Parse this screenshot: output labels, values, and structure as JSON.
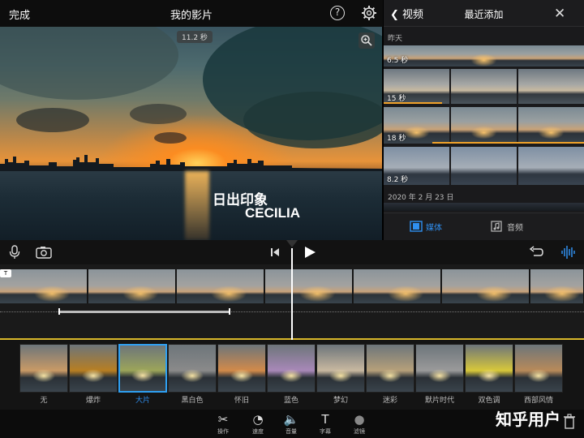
{
  "topbar": {
    "done": "完成",
    "title": "我的影片",
    "help": "?"
  },
  "preview": {
    "duration": "11.2 秒",
    "caption_line1": "日出印象",
    "caption_line2": "CECILIA"
  },
  "media": {
    "back": "视频",
    "title": "最近添加",
    "close": "✕",
    "section_yesterday": "昨天",
    "durations": [
      "6.5 秒",
      "15 秒",
      "18 秒",
      "8.2 秒"
    ],
    "section_date": "2020 年 2 月 23 日",
    "tab_media": "媒体",
    "tab_audio": "音频"
  },
  "filters": [
    {
      "label": "无",
      "color": "#c99a66"
    },
    {
      "label": "爆炸",
      "color": "#b77e22"
    },
    {
      "label": "大片",
      "color": "#9ca55a",
      "selected": true
    },
    {
      "label": "黑白色",
      "color": "#8a8a8a"
    },
    {
      "label": "怀旧",
      "color": "#d28a4a"
    },
    {
      "label": "蓝色",
      "color": "#a888b8"
    },
    {
      "label": "梦幻",
      "color": "#c8b8a0"
    },
    {
      "label": "迷彩",
      "color": "#b6a07a"
    },
    {
      "label": "默片时代",
      "color": "#9a9a9a"
    },
    {
      "label": "双色调",
      "color": "#d8c83a"
    },
    {
      "label": "西部风情",
      "color": "#b88a5a"
    }
  ],
  "tools": [
    {
      "label": "操作",
      "icon": "✂"
    },
    {
      "label": "速度",
      "icon": "◔"
    },
    {
      "label": "音量",
      "icon": "🔈"
    },
    {
      "label": "字幕",
      "icon": "T"
    },
    {
      "label": "滤镜",
      "icon": "●"
    }
  ],
  "watermark": "知乎用户",
  "colors": {
    "accent": "#2f8ff0",
    "timeline_line": "#d8b82a",
    "media_line": "#f0a22a"
  }
}
